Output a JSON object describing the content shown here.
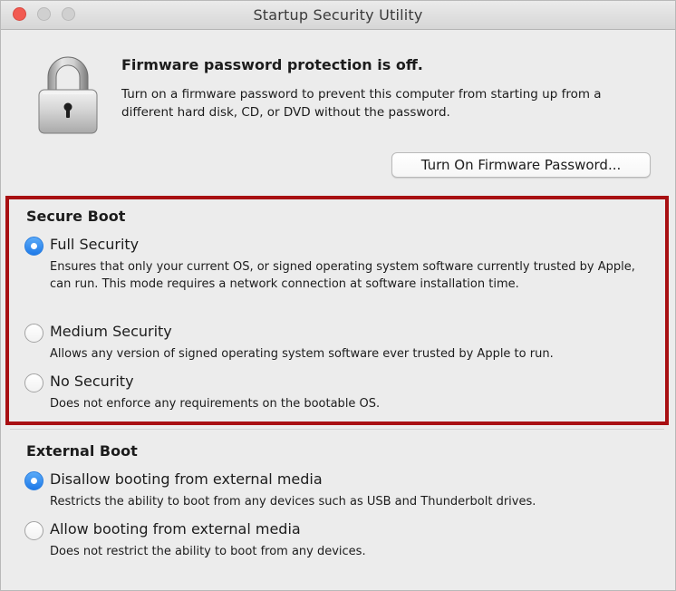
{
  "window": {
    "title": "Startup Security Utility"
  },
  "firmware": {
    "title": "Firmware password protection is off.",
    "description": "Turn on a firmware password to prevent this computer from starting up from a different hard disk, CD, or DVD without the password.",
    "button_label": "Turn On Firmware Password...",
    "icon": "lock-icon"
  },
  "secure_boot": {
    "title": "Secure Boot",
    "highlight_color": "#a80f12",
    "options": [
      {
        "label": "Full Security",
        "description": "Ensures that only your current OS, or signed operating system software currently trusted by Apple, can run. This mode requires a network connection at software installation time.",
        "selected": true
      },
      {
        "label": "Medium Security",
        "description": "Allows any version of signed operating system software ever trusted by Apple to run.",
        "selected": false
      },
      {
        "label": "No Security",
        "description": "Does not enforce any requirements on the bootable OS.",
        "selected": false
      }
    ]
  },
  "external_boot": {
    "title": "External Boot",
    "options": [
      {
        "label": "Disallow booting from external media",
        "description": "Restricts the ability to boot from any devices such as USB and Thunderbolt drives.",
        "selected": true
      },
      {
        "label": "Allow booting from external media",
        "description": "Does not restrict the ability to boot from any devices.",
        "selected": false
      }
    ]
  },
  "colors": {
    "accent": "#2b7fe0",
    "highlight_border": "#a80f12",
    "window_bg": "#ececec"
  }
}
